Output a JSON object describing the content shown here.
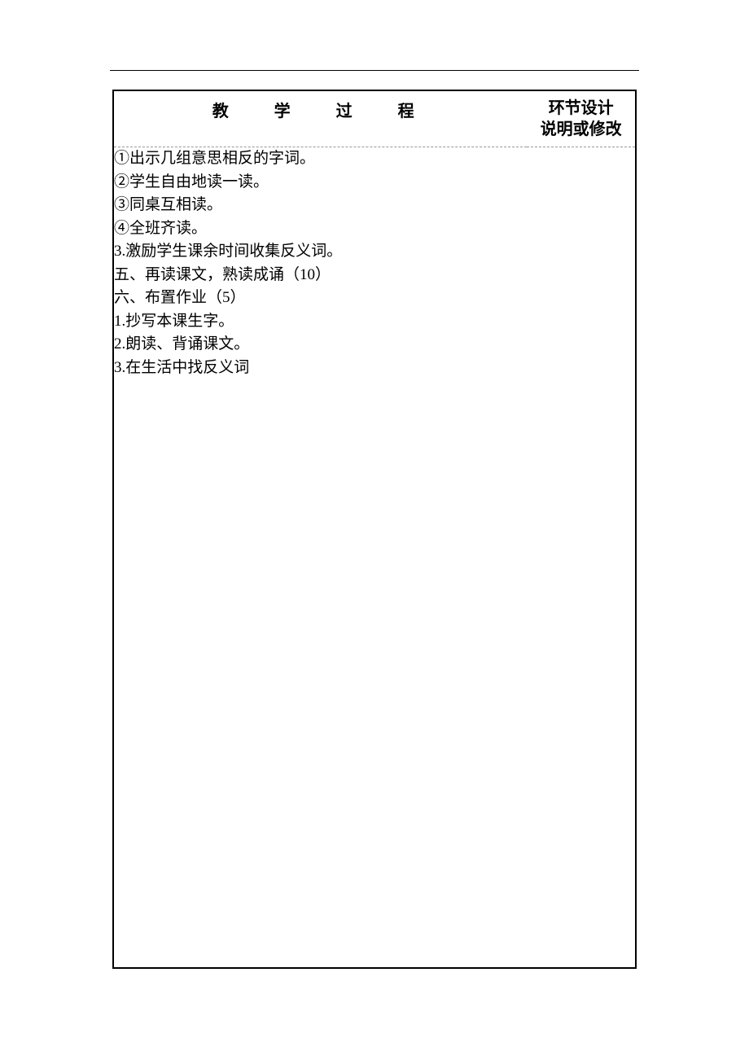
{
  "header": {
    "left": "教　学　过　程",
    "right_line1": "环节设计",
    "right_line2": "说明或修改"
  },
  "content": {
    "lines": [
      "①出示几组意思相反的字词。",
      "②学生自由地读一读。",
      "③同桌互相读。",
      "④全班齐读。",
      "3.激励学生课余时间收集反义词。",
      "五、再读课文，熟读成诵（10）",
      "六、布置作业（5）",
      "1.抄写本课生字。",
      "2.朗读、背诵课文。",
      "3.在生活中找反义词"
    ]
  }
}
